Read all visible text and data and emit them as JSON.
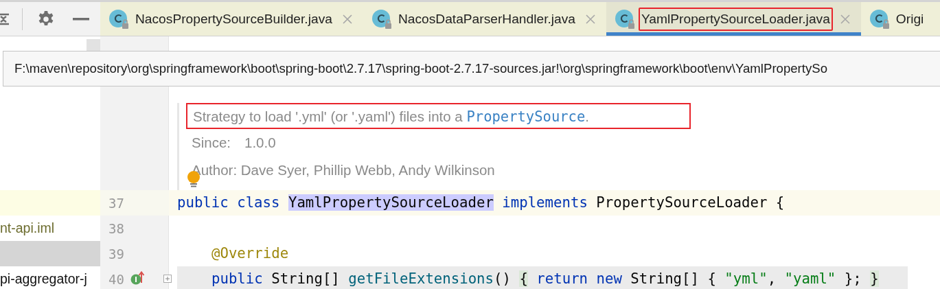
{
  "tabs": [
    {
      "label": "NacosPropertySourceBuilder.java",
      "selected": false,
      "annotated": false,
      "closable": true
    },
    {
      "label": "NacosDataParserHandler.java",
      "selected": false,
      "annotated": false,
      "closable": true
    },
    {
      "label": "YamlPropertySourceLoader.java",
      "selected": true,
      "annotated": true,
      "closable": true
    },
    {
      "label": "Origi",
      "selected": false,
      "annotated": false,
      "closable": false
    }
  ],
  "tooltip": {
    "path": "F:\\maven\\repository\\org\\springframework\\boot\\spring-boot\\2.7.17\\spring-boot-2.7.17-sources.jar!\\org\\springframework\\boot\\env\\YamlPropertySo"
  },
  "doc": {
    "summary": "Strategy to load '.yml' (or '.yaml') files into a ",
    "summary_link": "PropertySource",
    "summary_end": ".",
    "annotated": true,
    "since_label": "Since:",
    "since": "1.0.0",
    "author": "Author: Dave Syer, Phillip Webb, Andy Wilkinson"
  },
  "project_tree": {
    "items": [
      {
        "label": "nt-api.iml",
        "kind": "module-file"
      },
      {
        "label": "pi-aggregator-j",
        "kind": "folder"
      }
    ]
  },
  "code_lines": [
    {
      "number": "37",
      "current": true,
      "folded": false,
      "indented": false,
      "tokens": [
        {
          "kind": "keyword",
          "text": "public class "
        },
        {
          "kind": "match",
          "text": "YamlPropertySourceLoader"
        },
        {
          "kind": "keyword",
          "text": " implements"
        },
        {
          "kind": "plain",
          "text": " PropertySourceLoader {"
        }
      ]
    },
    {
      "number": "38",
      "current": false,
      "folded": false
    },
    {
      "number": "39",
      "current": false,
      "folded": false,
      "indented": true,
      "tokens": [
        {
          "kind": "annotation",
          "text": "@Override"
        }
      ]
    },
    {
      "number": "40",
      "current": false,
      "folded": true,
      "indented": true,
      "tokens": [
        {
          "kind": "keyword",
          "text": "public "
        },
        {
          "kind": "plain",
          "text": "String[] "
        },
        {
          "kind": "method",
          "text": "getFileExtensions"
        },
        {
          "kind": "plain",
          "text": "() "
        },
        {
          "kind": "brace",
          "text": "{"
        },
        {
          "kind": "keyword",
          "text": " return new"
        },
        {
          "kind": "plain",
          "text": " String[] { "
        },
        {
          "kind": "string",
          "text": "\"yml\""
        },
        {
          "kind": "plain",
          "text": ", "
        },
        {
          "kind": "string",
          "text": "\"yaml\""
        },
        {
          "kind": "plain",
          "text": " }; "
        },
        {
          "kind": "brace",
          "text": "}"
        }
      ]
    }
  ]
}
